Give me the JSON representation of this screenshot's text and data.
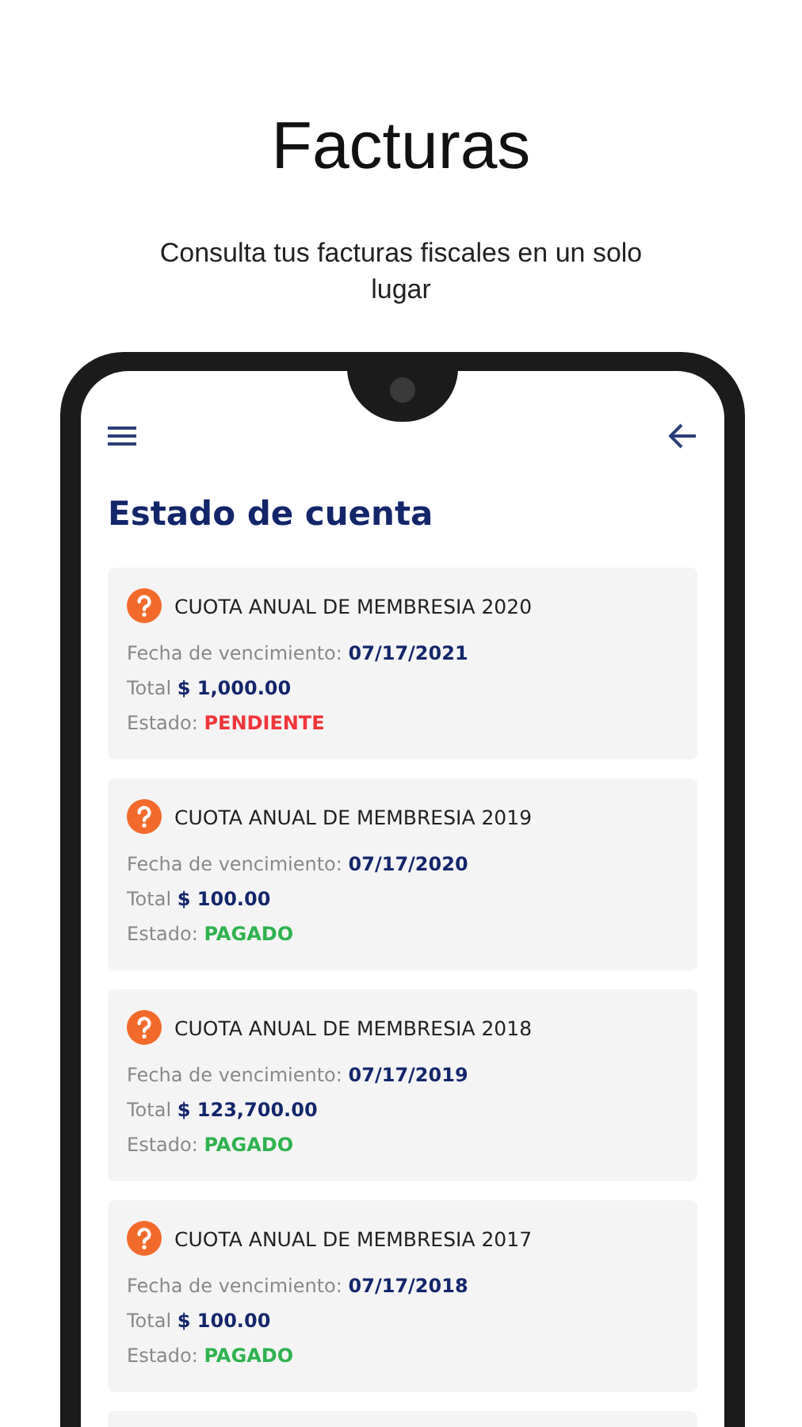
{
  "header": {
    "title": "Facturas",
    "subtitle": "Consulta tus facturas fiscales en un solo lugar"
  },
  "screen": {
    "title": "Estado de cuenta",
    "invoices": [
      {
        "title": "CUOTA ANUAL DE MEMBRESIA 2020",
        "due_label": "Fecha de vencimiento:",
        "due": "07/17/2021",
        "total_label": "Total",
        "total": "$ 1,000.00",
        "status_label": "Estado:",
        "status": "PENDIENTE",
        "kind": "pending"
      },
      {
        "title": "CUOTA ANUAL DE MEMBRESIA 2019",
        "due_label": "Fecha de vencimiento:",
        "due": "07/17/2020",
        "total_label": "Total",
        "total": "$ 100.00",
        "status_label": "Estado:",
        "status": "PAGADO",
        "kind": "paid"
      },
      {
        "title": "CUOTA ANUAL DE MEMBRESIA 2018",
        "due_label": "Fecha de vencimiento:",
        "due": "07/17/2019",
        "total_label": "Total",
        "total": "$ 123,700.00",
        "status_label": "Estado:",
        "status": "PAGADO",
        "kind": "paid"
      },
      {
        "title": "CUOTA ANUAL DE MEMBRESIA 2017",
        "due_label": "Fecha de vencimiento:",
        "due": "07/17/2018",
        "total_label": "Total",
        "total": "$ 100.00",
        "status_label": "Estado:",
        "status": "PAGADO",
        "kind": "paid"
      }
    ]
  }
}
